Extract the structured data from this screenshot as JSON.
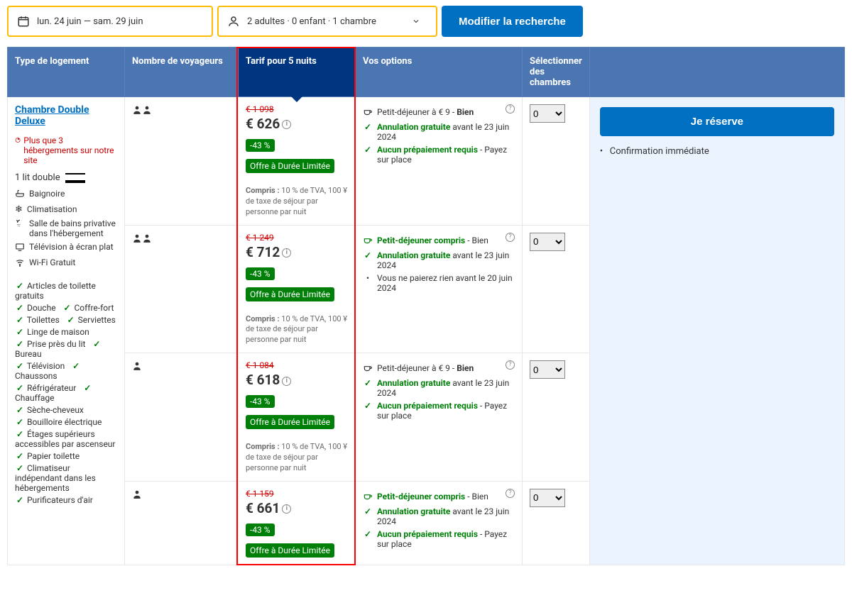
{
  "search": {
    "dates": "lun. 24 juin  —  sam. 29 juin",
    "guests": "2 adultes · 0 enfant · 1 chambre",
    "button": "Modifier la recherche"
  },
  "headers": {
    "type": "Type de logement",
    "guests": "Nombre de voyageurs",
    "price": "Tarif pour 5 nuits",
    "options": "Vos options",
    "select": "Sélectionner des chambres"
  },
  "room": {
    "name": "Chambre Double Deluxe",
    "scarcity": "Plus que 3 hébergements sur notre site",
    "bed": "1 lit double",
    "facilities": [
      {
        "icon": "bath",
        "label": "Baignoire"
      },
      {
        "icon": "ac",
        "label": "Climatisation"
      },
      {
        "icon": "shower",
        "label": "Salle de bains privative dans l'hébergement"
      },
      {
        "icon": "tv",
        "label": "Télévision à écran plat"
      },
      {
        "icon": "wifi",
        "label": "Wi-Fi Gratuit"
      }
    ],
    "amenities_rows": [
      [
        "Articles de toilette gratuits"
      ],
      [
        "Douche",
        "Coffre-fort"
      ],
      [
        "Toilettes",
        "Serviettes"
      ],
      [
        "Linge de maison"
      ],
      [
        "Prise près du lit",
        "Bureau"
      ],
      [
        "Télévision",
        "Chaussons"
      ],
      [
        "Réfrigérateur",
        "Chauffage"
      ],
      [
        "Sèche-cheveux"
      ],
      [
        "Bouilloire électrique"
      ],
      [
        "Étages supérieurs accessibles par ascenseur"
      ],
      [
        "Papier toilette"
      ],
      [
        "Climatiseur indépendant dans les hébergements"
      ],
      [
        "Purificateurs d'air"
      ]
    ]
  },
  "offers": [
    {
      "guests": 2,
      "strike": "€ 1 098",
      "price": "€ 626",
      "discount": "-43 %",
      "limited": "Offre à Durée Limitée",
      "includes_label": "Compris :",
      "includes": "10 % de TVA, 100 ¥ de taxe de séjour par personne par nuit",
      "opts": [
        {
          "type": "breakfast",
          "label": "Petit-déjeuner à € 9",
          "extra": " - ",
          "bold": "Bien",
          "color": "muted"
        },
        {
          "type": "check",
          "label": "Annulation gratuite",
          "tail": " avant le 23 juin 2024",
          "color": "green"
        },
        {
          "type": "check",
          "label": "Aucun prépaiement requis",
          "tail": " - Payez sur place",
          "color": "green"
        }
      ],
      "select": "0"
    },
    {
      "guests": 2,
      "strike": "€ 1 249",
      "price": "€ 712",
      "discount": "-43 %",
      "limited": "Offre à Durée Limitée",
      "includes_label": "Compris :",
      "includes": "10 % de TVA, 100 ¥ de taxe de séjour par personne par nuit",
      "opts": [
        {
          "type": "breakfast",
          "label": "Petit-déjeuner compris",
          "extra": " - Bien",
          "color": "green"
        },
        {
          "type": "check",
          "label": "Annulation gratuite",
          "tail": " avant le 23 juin 2024",
          "color": "green"
        },
        {
          "type": "bullet",
          "plain": "Vous ne paierez rien avant le 20 juin 2024"
        }
      ],
      "select": "0"
    },
    {
      "guests": 1,
      "strike": "€ 1 084",
      "price": "€ 618",
      "discount": "-43 %",
      "limited": "Offre à Durée Limitée",
      "includes_label": "Compris :",
      "includes": "10 % de TVA, 100 ¥ de taxe de séjour par personne par nuit",
      "opts": [
        {
          "type": "breakfast",
          "label": "Petit-déjeuner à € 9",
          "extra": " - ",
          "bold": "Bien",
          "color": "muted"
        },
        {
          "type": "check",
          "label": "Annulation gratuite",
          "tail": " avant le 23 juin 2024",
          "color": "green"
        },
        {
          "type": "check",
          "label": "Aucun prépaiement requis",
          "tail": " - Payez sur place",
          "color": "green"
        }
      ],
      "select": "0"
    },
    {
      "guests": 1,
      "strike": "€ 1 159",
      "price": "€ 661",
      "discount": "-43 %",
      "limited": "Offre à Durée Limitée",
      "includes_label": "",
      "includes": "",
      "opts": [
        {
          "type": "breakfast",
          "label": "Petit-déjeuner compris",
          "extra": " - Bien",
          "color": "green"
        },
        {
          "type": "check",
          "label": "Annulation gratuite",
          "tail": " avant le 23 juin 2024",
          "color": "green"
        },
        {
          "type": "check",
          "label": "Aucun prépaiement requis",
          "tail": " - Payez sur place",
          "color": "green"
        }
      ],
      "select": "0"
    }
  ],
  "reserve": {
    "button": "Je réserve",
    "confirm": "Confirmation immédiate"
  }
}
